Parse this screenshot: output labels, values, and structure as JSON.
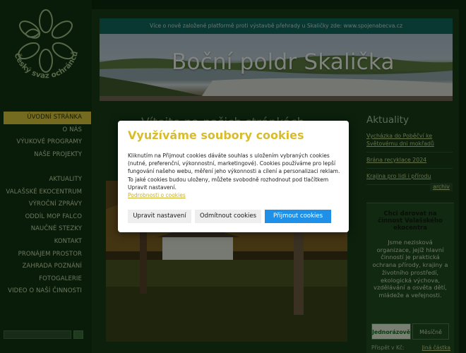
{
  "banner": {
    "announce": "Více o nově založené platformě proti výstavbě přehrady u Skaličky zde: www.spojenabecva.cz",
    "title": "Boční poldr Skalička"
  },
  "logo": {
    "text": "Český svaz ochránců přírody"
  },
  "nav": {
    "items": [
      {
        "label": "Úvodní stránka",
        "active": true
      },
      {
        "label": "O nás"
      },
      {
        "label": "Výukové programy"
      },
      {
        "label": "Naše projekty"
      },
      {
        "label": "Aktuality"
      },
      {
        "label": "Valašské ekocentrum"
      },
      {
        "label": "Výroční zprávy"
      },
      {
        "label": "Oddíl MOP Falco"
      },
      {
        "label": "Naučné stezky"
      },
      {
        "label": "Kontakt"
      },
      {
        "label": "Pronájem prostor"
      },
      {
        "label": "Zahrada poznání"
      },
      {
        "label": "Fotogalerie"
      },
      {
        "label": "Video o naší činnosti"
      }
    ]
  },
  "content": {
    "heading": "Vítejte na našich stránkách"
  },
  "news": {
    "title": "Aktuality",
    "items": [
      "Vycházka do Poběčví ke Světovému dni mokřadů",
      "Brána recyklace 2024",
      "Krajina pro lidi i přírodu"
    ],
    "archive": "archiv"
  },
  "donate": {
    "title": "Chci darovat na činnost Valašského ekocentra",
    "text": "Jsme nezisková organizace, jejíž hlavní činností je praktická ochrana přírody, krajiny a životního prostředí, ekologická výchova, vzdělávání a osvěta dětí, mládeže a veřejnosti.",
    "tab_one": "Jednorázově",
    "tab_two": "Měsíčně",
    "amount_label": "Přispět v Kč:",
    "other_amount": "Jiná částka"
  },
  "cookie": {
    "title": "Využíváme soubory cookies",
    "text": "Kliknutím na Přijmout cookies dáváte souhlas s uložením vybraných cookies (nutné, preferenční, výkonnostní, marketingové). Cookies používáme pro lepší fungování našeho webu, měření jeho výkonnosti a cílení a personalizaci reklam. To jaké cookies budou uloženy, můžete svobodně rozhodnout pod tlačítkem Upravit nastavení.",
    "link": "Podrobnosti o cookies",
    "btn_settings": "Upravit nastavení",
    "btn_reject": "Odmítnout cookies",
    "btn_accept": "Přijmout cookies"
  },
  "colors": {
    "accent": "#d6c43b",
    "cookie_title": "#d9bc2c",
    "accept_button": "#1e90e8",
    "announce_bar": "#12675e"
  }
}
